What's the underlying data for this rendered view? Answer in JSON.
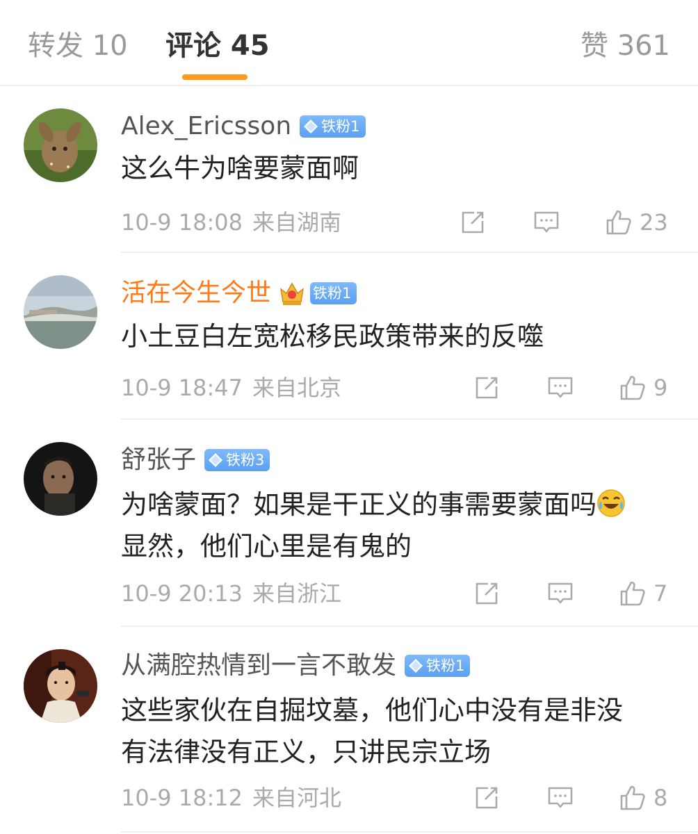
{
  "tabs": {
    "repost": "转发 10",
    "comments": "评论 45",
    "likes": "赞 361"
  },
  "colors": {
    "accent": "#ff9a1a",
    "badge": "#5c9ff2",
    "vip_name": "#ff7a18"
  },
  "comments": [
    {
      "name": "Alex_Ericsson",
      "badge": "铁粉1",
      "text": "这么牛为啥要蒙面啊",
      "time": "10-9 18:08",
      "source": "来自湖南",
      "likes": "23",
      "avatar_icon": "deer-avatar"
    },
    {
      "name": "活在今生今世",
      "badge": "铁粉1",
      "vip_icon": "crown-icon",
      "text": "小土豆白左宽松移民政策带来的反噬",
      "time": "10-9 18:47",
      "source": "来自北京",
      "likes": "9",
      "avatar_icon": "aerial-city-avatar"
    },
    {
      "name": "舒张子",
      "badge": "铁粉3",
      "text_line1": "为啥蒙面？如果是干正义的事需要蒙面吗",
      "text_line2": "显然，他们心里是有鬼的",
      "emoji": "laugh-cry-emoji",
      "time": "10-9 20:13",
      "source": "来自浙江",
      "likes": "7",
      "avatar_icon": "portrait-avatar"
    },
    {
      "name": "从满腔热情到一言不敢发",
      "badge": "铁粉1",
      "text_line1": "这些家伙在自掘坟墓，他们心中没有是非没",
      "text_line2": "有法律没有正义，只讲民宗立场",
      "time": "10-9 18:12",
      "source": "来自河北",
      "likes": "8",
      "avatar_icon": "costume-drama-avatar"
    }
  ]
}
